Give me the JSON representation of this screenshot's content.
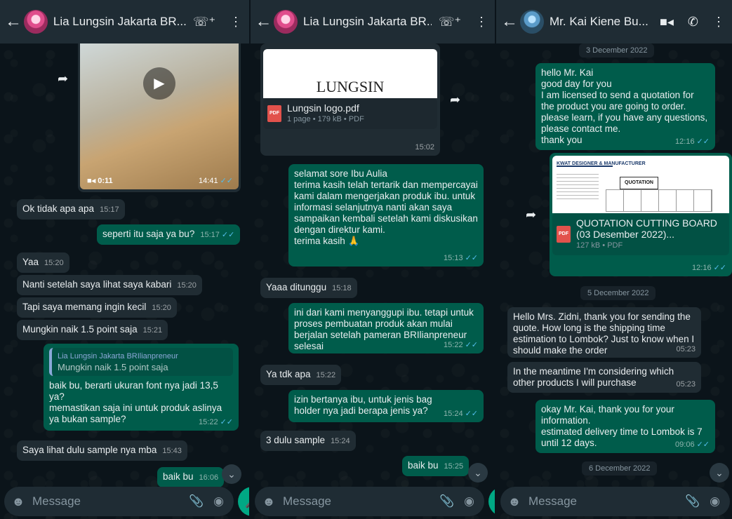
{
  "panels": [
    {
      "title": "Lia Lungsin Jakarta BR...",
      "input_placeholder": "Message",
      "video": {
        "duration": "0:11",
        "time": "14:41"
      },
      "messages": [
        {
          "text": "Ok tidak apa apa",
          "time": "15:17"
        },
        {
          "text": "seperti itu saja ya bu?",
          "time": "15:17"
        },
        {
          "text": "Yaa",
          "time": "15:20"
        },
        {
          "text": "Nanti setelah saya lihat saya kabari",
          "time": "15:20"
        },
        {
          "text": "Tapi saya memang ingin kecil",
          "time": "15:20"
        },
        {
          "text": "Mungkin naik 1.5 point saja",
          "time": "15:21"
        },
        {
          "quote_name": "Lia Lungsin Jakarta BRIlianpreneur",
          "quote_text": "Mungkin naik 1.5 point saja",
          "text": "baik bu, berarti ukuran font nya jadi 13,5 ya?\nmemastikan saja ini untuk produk aslinya ya bukan sample?",
          "time": "15:22"
        },
        {
          "text": "Saya lihat dulu sample nya mba",
          "time": "15:43"
        },
        {
          "text": "baik bu",
          "time": "16:06"
        }
      ]
    },
    {
      "title": "Lia Lungsin Jakarta BR...",
      "input_placeholder": "Message",
      "doc": {
        "preview_text": "LUNGSIN",
        "name": "Lungsin logo.pdf",
        "meta": "1 page • 179 kB • PDF",
        "time": "15:02"
      },
      "messages": [
        {
          "text": "selamat sore Ibu Aulia\nterima kasih telah tertarik dan mempercayai kami dalam mengerjakan produk ibu. untuk informasi selanjutnya nanti akan saya sampaikan kembali setelah kami diskusikan dengan direktur kami.\nterima kasih 🙏",
          "time": "15:13"
        },
        {
          "text": "Yaaa ditunggu",
          "time": "15:18"
        },
        {
          "text": "ini dari kami menyanggupi ibu. tetapi untuk proses pembuatan produk akan mulai berjalan setelah pameran BRIlianpreneur selesai",
          "time": "15:22"
        },
        {
          "text": "Ya tdk apa",
          "time": "15:22"
        },
        {
          "text": "izin bertanya ibu, untuk jenis bag holder nya jadi berapa jenis ya?",
          "time": "15:24"
        },
        {
          "text": "3 dulu sample",
          "time": "15:24"
        },
        {
          "text": "baik bu",
          "time": "15:25"
        }
      ]
    },
    {
      "title": "Mr. Kai Kiene Bu...",
      "input_placeholder": "Message",
      "dates": [
        "3 December 2022",
        "5 December 2022",
        "6 December 2022"
      ],
      "doc": {
        "name": "QUOTATION CUTTING BOARD (03 Desember 2022)...",
        "meta": "127 kB • PDF",
        "time": "12:16",
        "preview_heading": "QUOTATION",
        "preview_brand": "KWAT DESIGNER & MANUFACTURER"
      },
      "messages": [
        {
          "text": "hello Mr. Kai\ngood day for you\nI am licensed to send a quotation for the product you are going to order. please learn, if you have any questions, please contact me.\nthank you",
          "time": "12:16"
        },
        {
          "text": "Hello Mrs. Zidni, thank you for sending the quote. How long is the shipping time estimation to Lombok? Just to know when I should make the order",
          "time": "05:23"
        },
        {
          "text": "In the meantime I'm considering which other products I will purchase",
          "time": "05:23"
        },
        {
          "text": "okay Mr. Kai, thank you for your information.\nestimated delivery time to Lombok is 7 until 12 days.",
          "time": "09:06"
        }
      ]
    }
  ],
  "colors": {
    "incoming": "#202c33",
    "outgoing": "#005c4b",
    "header": "#1f2c34",
    "accent": "#00a884",
    "read_tick": "#53bdeb"
  },
  "icons": [
    "back-arrow-icon",
    "add-call-icon",
    "video-call-icon",
    "voice-call-icon",
    "more-options-icon",
    "emoji-icon",
    "attach-icon",
    "camera-icon",
    "mic-icon",
    "forward-icon",
    "play-icon",
    "pdf-icon",
    "scroll-down-icon"
  ]
}
